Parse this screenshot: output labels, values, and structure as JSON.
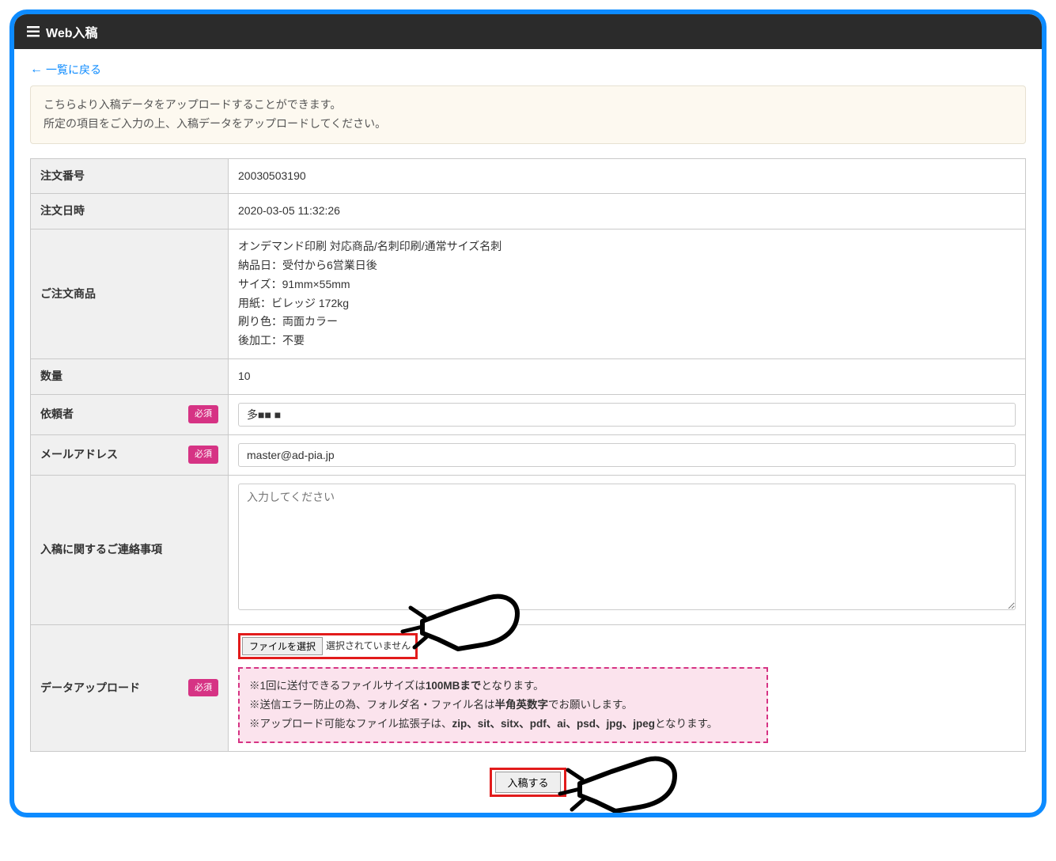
{
  "header": {
    "title": "Web入稿"
  },
  "back_link": "一覧に戻る",
  "info_box": {
    "line1": "こちらより入稿データをアップロードすることができます。",
    "line2": "所定の項目をご入力の上、入稿データをアップロードしてください。"
  },
  "labels": {
    "order_number": "注文番号",
    "order_datetime": "注文日時",
    "order_product": "ご注文商品",
    "quantity": "数量",
    "requester": "依頼者",
    "email": "メールアドレス",
    "notes": "入稿に関するご連絡事項",
    "upload": "データアップロード",
    "required": "必須"
  },
  "values": {
    "order_number": "20030503190",
    "order_datetime": "2020-03-05 11:32:26",
    "order_product": "オンデマンド印刷 対応商品/名刺印刷/通常サイズ名刺\n納品日：受付から6営業日後\nサイズ：91mm×55mm\n用紙：ビレッジ 172kg\n刷り色：両面カラー\n後加工：不要",
    "quantity": "10",
    "requester": "多■■ ■",
    "email": "master@ad-pia.jp",
    "notes_placeholder": "入力してください",
    "file_button": "ファイルを選択",
    "file_status": "選択されていません"
  },
  "upload_note": {
    "line1_pre": "※1回に送付できるファイルサイズは",
    "line1_bold": "100MBまで",
    "line1_post": "となります。",
    "line2_pre": "※送信エラー防止の為、フォルダ名・ファイル名は",
    "line2_bold": "半角英数字",
    "line2_post": "でお願いします。",
    "line3_pre": "※アップロード可能なファイル拡張子は、",
    "line3_bold": "zip、sit、sitx、pdf、ai、psd、jpg、jpeg",
    "line3_post": "となります。"
  },
  "submit": {
    "label": "入稿する"
  }
}
